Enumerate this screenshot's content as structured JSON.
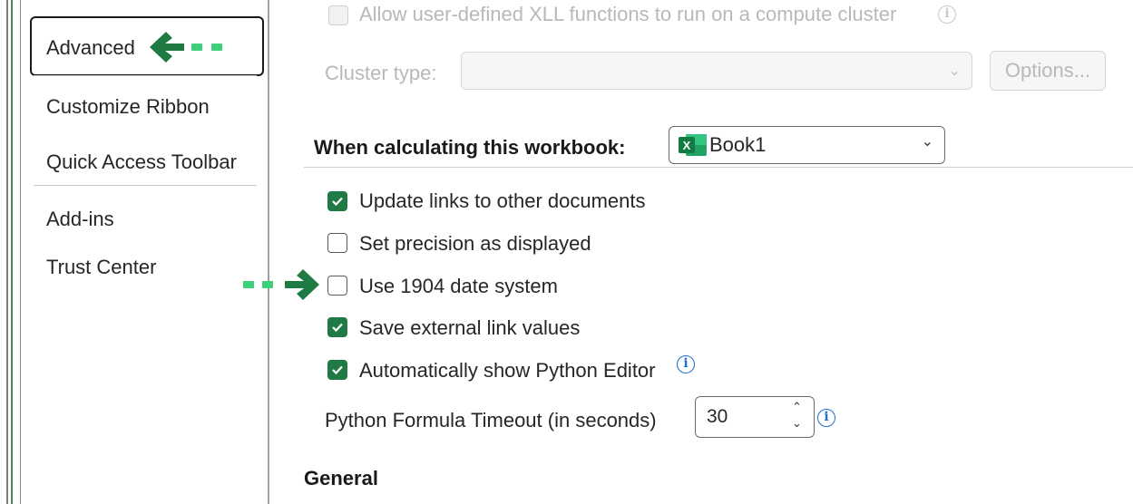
{
  "nav": {
    "items": [
      {
        "label": "Advanced",
        "selected": true
      },
      {
        "label": "Customize Ribbon"
      },
      {
        "label": "Quick Access Toolbar"
      },
      {
        "label": "Add-ins"
      },
      {
        "label": "Trust Center"
      }
    ]
  },
  "cluster": {
    "allow_xll_label": "Allow user-defined XLL functions to run on a compute cluster",
    "cluster_type_label": "Cluster type:",
    "cluster_type_value": "",
    "options_button": "Options..."
  },
  "workbook_section": {
    "heading": "When calculating this workbook:",
    "selected_workbook": "Book1"
  },
  "options": [
    {
      "label": "Update links to other documents",
      "checked": true
    },
    {
      "label": "Set precision as displayed",
      "checked": false
    },
    {
      "label": "Use 1904 date system",
      "checked": false
    },
    {
      "label": "Save external link values",
      "checked": true
    },
    {
      "label": "Automatically show Python Editor",
      "checked": true
    }
  ],
  "python_timeout": {
    "label": "Python Formula Timeout (in seconds)",
    "value": "30"
  },
  "general_heading": "General",
  "colors": {
    "accent_green": "#1f7a43",
    "arrow_green": "#1f7a43",
    "dash_green": "#3ecf7a",
    "info_blue": "#1d6fd0"
  }
}
